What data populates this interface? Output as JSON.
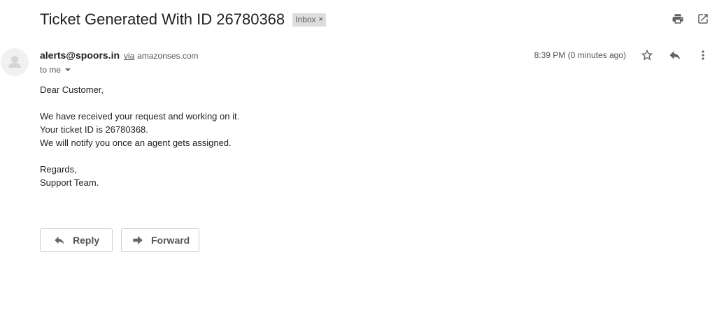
{
  "email": {
    "subject": "Ticket Generated With ID 26780368",
    "label": "Inbox",
    "label_close": "×",
    "sender": {
      "name": "alerts@spoors.in",
      "via_word": "via",
      "via_domain": "amazonses.com"
    },
    "recipient_text": "to me",
    "timestamp": "8:39 PM (0 minutes ago)",
    "body_lines": [
      "Dear Customer,",
      "",
      "We have received your request and working on it.",
      "Your ticket ID is 26780368.",
      "We will notify you once an agent gets assigned.",
      "",
      "Regards,",
      "Support Team."
    ]
  },
  "toolbar": {
    "icons": [
      "print-icon",
      "open-in-new-window-icon"
    ]
  },
  "message_actions": {
    "icons": [
      "star-icon",
      "reply-icon",
      "more-vert-icon"
    ]
  },
  "actions": {
    "reply_label": "Reply",
    "forward_label": "Forward"
  },
  "colors": {
    "text_primary": "#222222",
    "text_secondary": "#555555",
    "icon_gray": "#5f6368",
    "chip_bg": "#dddddd",
    "button_border": "#cfcfcf"
  }
}
